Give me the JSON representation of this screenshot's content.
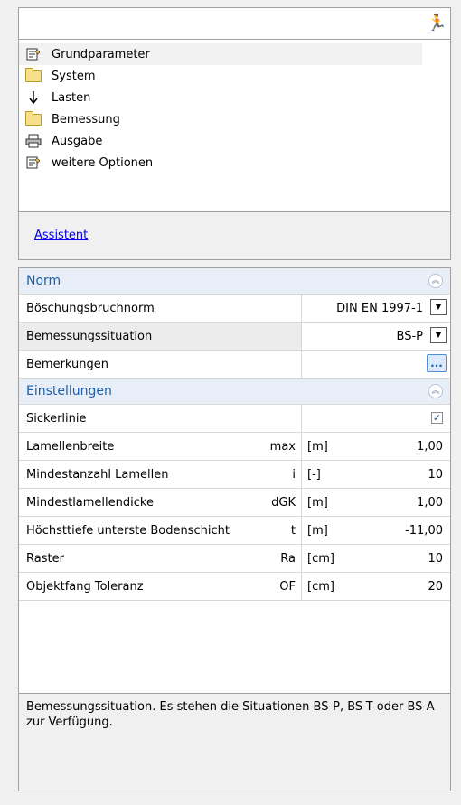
{
  "toolbar": {
    "runner_icon": "runner-icon"
  },
  "tree": {
    "items": [
      {
        "label": "Grundparameter",
        "icon": "properties-icon"
      },
      {
        "label": "System",
        "icon": "folder-icon"
      },
      {
        "label": "Lasten",
        "icon": "arrow-down-icon"
      },
      {
        "label": "Bemessung",
        "icon": "folder-icon"
      },
      {
        "label": "Ausgabe",
        "icon": "printer-icon"
      },
      {
        "label": "weitere Optionen",
        "icon": "properties-icon"
      }
    ]
  },
  "assistant": {
    "label": "Assistent"
  },
  "norm": {
    "title": "Norm",
    "rows": [
      {
        "label": "Böschungsbruchnorm",
        "value": "DIN EN 1997-1"
      },
      {
        "label": "Bemessungssituation",
        "value": "BS-P"
      },
      {
        "label": "Bemerkungen",
        "button": "..."
      }
    ]
  },
  "einstellungen": {
    "title": "Einstellungen",
    "sickerlinie": {
      "label": "Sickerlinie",
      "checked": true,
      "check": "✓"
    },
    "rows": [
      {
        "label": "Lamellenbreite",
        "symbol": "max",
        "unit": "[m]",
        "value": "1,00"
      },
      {
        "label": "Mindestanzahl Lamellen",
        "symbol": "i",
        "unit": "[-]",
        "value": "10"
      },
      {
        "label": "Mindestlamellendicke",
        "symbol": "dGK",
        "unit": "[m]",
        "value": "1,00"
      },
      {
        "label": "Höchsttiefe unterste Bodenschicht",
        "symbol": "t",
        "unit": "[m]",
        "value": "-11,00"
      },
      {
        "label": "Raster",
        "symbol": "Ra",
        "unit": "[cm]",
        "value": "10"
      },
      {
        "label": "Objektfang Toleranz",
        "symbol": "OF",
        "unit": "[cm]",
        "value": "20"
      }
    ]
  },
  "description": {
    "text": "Bemessungssituation. Es stehen die Situationen BS-P, BS-T oder BS-A zur Verfügung."
  },
  "colors": {
    "accent": "#1f5fa8",
    "section_bg": "#e8eef8",
    "link": "#0000ee"
  }
}
